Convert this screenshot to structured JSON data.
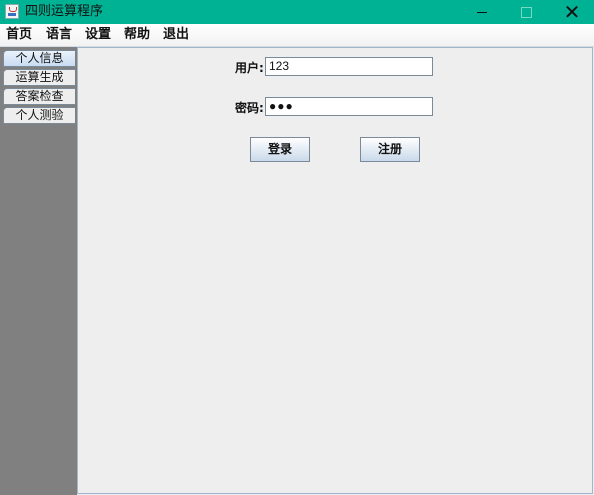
{
  "window": {
    "title": "四则运算程序",
    "minimize_glyph": "—",
    "maximize_glyph": "□",
    "close_glyph": "✕"
  },
  "menu": {
    "items": [
      {
        "label": "首页"
      },
      {
        "label": "语言"
      },
      {
        "label": "设置"
      },
      {
        "label": "帮助"
      },
      {
        "label": "退出"
      }
    ]
  },
  "tabs": [
    {
      "label": "个人信息",
      "selected": true
    },
    {
      "label": "运算生成",
      "selected": false
    },
    {
      "label": "答案检查",
      "selected": false
    },
    {
      "label": "个人测验",
      "selected": false
    }
  ],
  "login": {
    "user_label": "用户:",
    "user_value": "123",
    "password_label": "密码:",
    "password_masked": "●●●",
    "login_button": "登录",
    "register_button": "注册"
  },
  "colors": {
    "titlebar": "#00b294",
    "side_panel": "#808080",
    "content_bg": "#eeeeee"
  },
  "icons": [
    "app-java-icon",
    "minimize-icon",
    "maximize-icon",
    "close-icon"
  ]
}
